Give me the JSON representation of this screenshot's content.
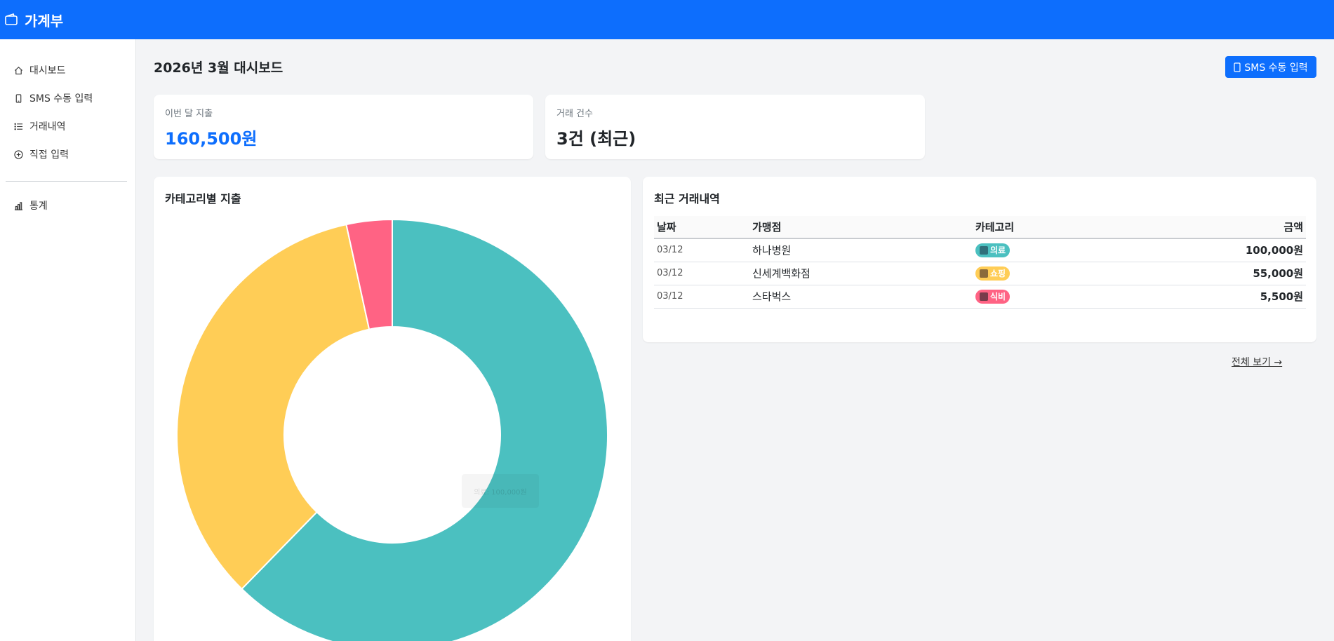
{
  "app": {
    "title": "가계부"
  },
  "sidebar": {
    "items": [
      {
        "label": "대시보드",
        "icon": "home-icon"
      },
      {
        "label": "SMS 수동 입력",
        "icon": "phone-icon"
      },
      {
        "label": "거래내역",
        "icon": "list-icon"
      },
      {
        "label": "직접 입력",
        "icon": "plus-circle-icon"
      }
    ],
    "secondary": [
      {
        "label": "통계",
        "icon": "bar-chart-icon"
      }
    ]
  },
  "header": {
    "title": "2026년 3월 대시보드",
    "sms_button": "SMS 수동 입력"
  },
  "stats": {
    "month_spend_label": "이번 달 지출",
    "month_spend_value": "160,500원",
    "tx_count_label": "거래 건수",
    "tx_count_value": "3건 (최근)"
  },
  "category_chart": {
    "title": "카테고리별 지출",
    "tooltip": "의료: 100,000원"
  },
  "chart_data": {
    "type": "pie",
    "title": "카테고리별 지출",
    "donut": true,
    "categories": [
      "의료",
      "쇼핑",
      "식비"
    ],
    "values": [
      100000,
      55000,
      5500
    ],
    "colors": [
      "#4bc0c0",
      "#ffcd56",
      "#ff6384"
    ]
  },
  "recent": {
    "title": "최근 거래내역",
    "columns": [
      "날짜",
      "가맹점",
      "카테고리",
      "금액"
    ],
    "rows": [
      {
        "date": "03/12",
        "merchant": "하나병원",
        "category": "의료",
        "color": "#4bc0c0",
        "icon": "hospital-icon",
        "amount": "100,000원"
      },
      {
        "date": "03/12",
        "merchant": "신세계백화점",
        "category": "쇼핑",
        "color": "#ffcd56",
        "icon": "shopping-bag-icon",
        "amount": "55,000원"
      },
      {
        "date": "03/12",
        "merchant": "스타벅스",
        "category": "식비",
        "color": "#ff6384",
        "icon": "food-icon",
        "amount": "5,500원"
      }
    ],
    "see_all": "전체 보기 →"
  }
}
